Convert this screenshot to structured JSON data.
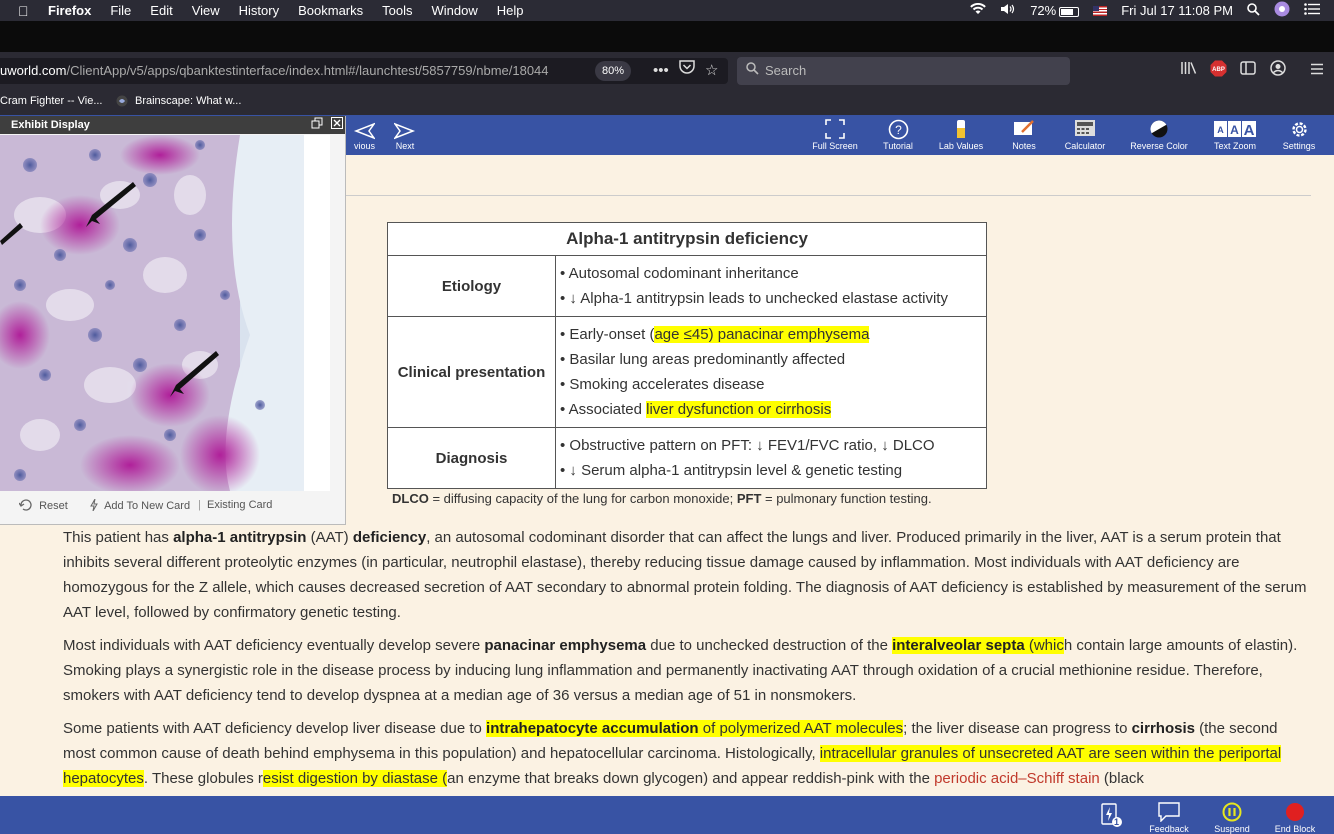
{
  "menubar": {
    "app": "Firefox",
    "items": [
      "File",
      "Edit",
      "View",
      "History",
      "Bookmarks",
      "Tools",
      "Window",
      "Help"
    ],
    "battery": "72%",
    "clock": "Fri Jul 17  11:08 PM"
  },
  "browser": {
    "url_host": "uworld.com",
    "url_path": "/ClientApp/v5/apps/qbanktestinterface/index.html#/launchtest/5857759/nbme/18044",
    "zoom": "80%",
    "search_placeholder": "Search",
    "bookmarks": [
      "Cram Fighter -- Vie...",
      "Brainscape: What w..."
    ]
  },
  "toolbar": {
    "previous": "vious",
    "next": "Next",
    "tools": [
      "Full Screen",
      "Tutorial",
      "Lab Values",
      "Notes",
      "Calculator",
      "Reverse Color",
      "Text Zoom",
      "Settings"
    ]
  },
  "exhibit": {
    "title": "Exhibit Display",
    "reset": "Reset",
    "add_card": "Add To New Card",
    "existing_card": "Existing Card"
  },
  "table": {
    "title": "Alpha-1 antitrypsin deficiency",
    "rows": [
      {
        "head": "Etiology",
        "items": [
          {
            "pre": "Autosomal codominant inheritance",
            "hl": "",
            "post": ""
          },
          {
            "pre": "↓ Alpha-1 antitrypsin leads to unchecked elastase activity",
            "hl": "",
            "post": ""
          }
        ]
      },
      {
        "head": "Clinical presentation",
        "items": [
          {
            "pre": "Early-onset (",
            "hl": "age ≤45) panacinar emphysema",
            "post": ""
          },
          {
            "pre": "Basilar lung areas predominantly affected",
            "hl": "",
            "post": ""
          },
          {
            "pre": "Smoking accelerates disease",
            "hl": "",
            "post": ""
          },
          {
            "pre": "Associated ",
            "hl": "liver dysfunction or cirrhosis ",
            "post": ""
          }
        ]
      },
      {
        "head": "Diagnosis",
        "items": [
          {
            "pre": "Obstructive pattern on PFT: ↓ FEV1/FVC ratio, ↓ DLCO",
            "hl": "",
            "post": ""
          },
          {
            "pre": "↓ Serum alpha-1 antitrypsin level & genetic testing",
            "hl": "",
            "post": ""
          }
        ]
      }
    ],
    "footnote_b1": "DLCO",
    "footnote_t1": " = diffusing capacity of the lung for carbon monoxide; ",
    "footnote_b2": "PFT",
    "footnote_t2": " = pulmonary function testing."
  },
  "paragraphs": {
    "p1": {
      "t1": "This patient has ",
      "b1": "alpha-1 antitrypsin",
      "t2": " (AAT) ",
      "b2": "deficiency",
      "t3": ", an autosomal codominant disorder that can affect the lungs and liver.  Produced primarily in the liver, AAT is a serum protein that inhibits several different proteolytic enzymes (in particular, neutrophil elastase), thereby reducing tissue damage caused by inflammation.  Most individuals with AAT deficiency are homozygous for the Z allele, which causes decreased secretion of AAT secondary to abnormal protein folding.  The diagnosis of AAT deficiency is established by measurement of the serum AAT level, followed by confirmatory genetic testing."
    },
    "p2": {
      "t1": "Most individuals with AAT deficiency eventually develop severe ",
      "b1": "panacinar emphysema",
      "t2": " due to unchecked destruction of the ",
      "hl_b": "interalveolar septa",
      "hl_t": " (whic",
      "t3": "h contain large amounts of elastin).  Smoking plays a synergistic role in the disease process by inducing lung inflammation and permanently inactivating AAT through oxidation of a crucial methionine residue.  Therefore, smokers with AAT deficiency tend to develop dyspnea at a median age of 36 versus a median age of 51 in nonsmokers."
    },
    "p3": {
      "t1": "Some patients with AAT deficiency develop liver disease due to ",
      "hl1_b": "intrahepatocyte accumulation",
      "hl1_t": " of polymerized AAT molecules",
      "t2": "; the liver disease can progress to ",
      "b1": "cirrhosis",
      "t3": " (the second most common cause of death behind emphysema in this population) and hepatocellular carcinoma.  Histologically, ",
      "hl2": "intracellular granules of unsecreted AAT are seen within the periportal hepatocytes",
      "t4": ".  These globules r",
      "hl3": "esist digestion by diastase (",
      "t5": "an enzyme that breaks down glycogen) and appear reddish-pink with the ",
      "link": "periodic acid–Schiff stain",
      "t6": " (black"
    }
  },
  "bottombar": {
    "tools": [
      "Feedback",
      "Suspend",
      "End Block"
    ],
    "badge": "1"
  },
  "colors": {
    "header_blue": "#3853a4",
    "content_bg": "#fbf2e3",
    "highlight": "#ffff00",
    "link_red": "#c0392b"
  }
}
